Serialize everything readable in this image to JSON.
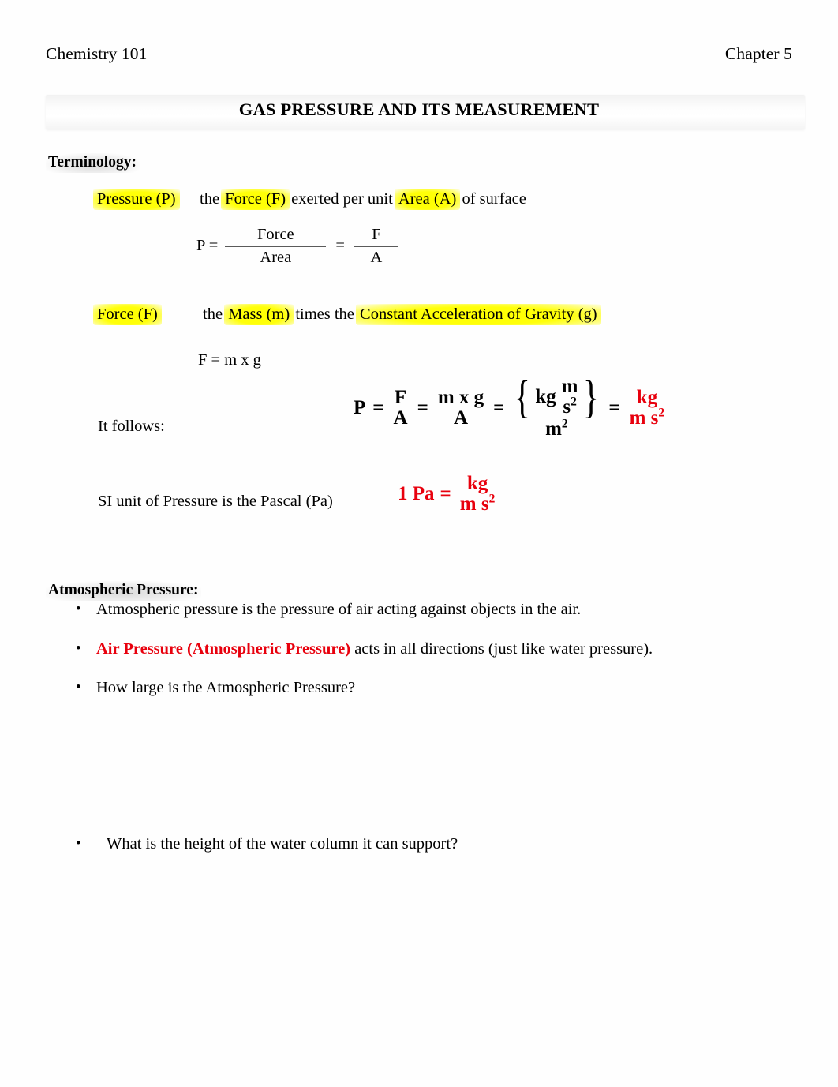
{
  "header": {
    "course": "Chemistry 101",
    "chapter": "Chapter 5"
  },
  "title": "GAS PRESSURE AND ITS MEASUREMENT",
  "sections": {
    "terminology": {
      "heading": "Terminology:",
      "definitions": [
        {
          "term": "Pressure (P)",
          "text_before": "the ",
          "highlight_1": "Force (F)",
          "text_middle": " exerted per unit ",
          "highlight_2": "Area (A)",
          "text_after": " of surface"
        },
        {
          "term": "Force (F)",
          "text_before": "the ",
          "highlight_1": "Mass (m)",
          "text_middle": " times the ",
          "highlight_2": "Constant Acceleration of Gravity (g)",
          "text_after": ""
        }
      ],
      "formula_pressure": {
        "lead": "P =",
        "numerator_1": "Force",
        "denominator_1": "Area",
        "equals": "=",
        "numerator_2": "F",
        "denominator_2": "A"
      },
      "formula_force": "F = m x g",
      "it_follows_label": "It follows:",
      "big_equation": {
        "p": "P",
        "eq1": "=",
        "f_over_a_num": "F",
        "f_over_a_den": "A",
        "eq2": "=",
        "mxg_num": "m x g",
        "mxg_den": "A",
        "eq3": "=",
        "brace_open": "{",
        "brace_kg": "kg",
        "brace_m": "m",
        "brace_s": "s",
        "brace_s_exp": "2",
        "brace_close": "}",
        "brace_den_m": "m",
        "brace_den_exp": "2",
        "eq4": "=",
        "result_num": "kg",
        "result_den_m": "m s",
        "result_den_exp": "2"
      },
      "si_unit_label": "SI unit of Pressure is the Pascal (Pa)",
      "pascal_equation": {
        "lead": "1 Pa",
        "equals": "=",
        "numerator": "kg",
        "denominator": "m s",
        "denominator_exp": "2"
      }
    },
    "atmospheric": {
      "heading": "Atmospheric Pressure:",
      "bullets": [
        {
          "marker": "•",
          "plain": "Atmospheric pressure is the pressure of air acting against objects in the air."
        },
        {
          "marker": "•",
          "red_part": "Air Pressure (Atmospheric Pressure)",
          "rest": " acts in all directions (just like water pressure)."
        },
        {
          "marker": "•",
          "plain": "How large is the Atmospheric Pressure?"
        },
        {
          "marker": "•",
          "plain": "What is the height of the water column it can support?"
        }
      ]
    }
  },
  "colors": {
    "text": "#000000",
    "accent_red": "#e8000d",
    "highlight_yellow": "#ffff00",
    "band_gray": "#f2f2f2",
    "rule_gray": "#5a5a5a"
  }
}
